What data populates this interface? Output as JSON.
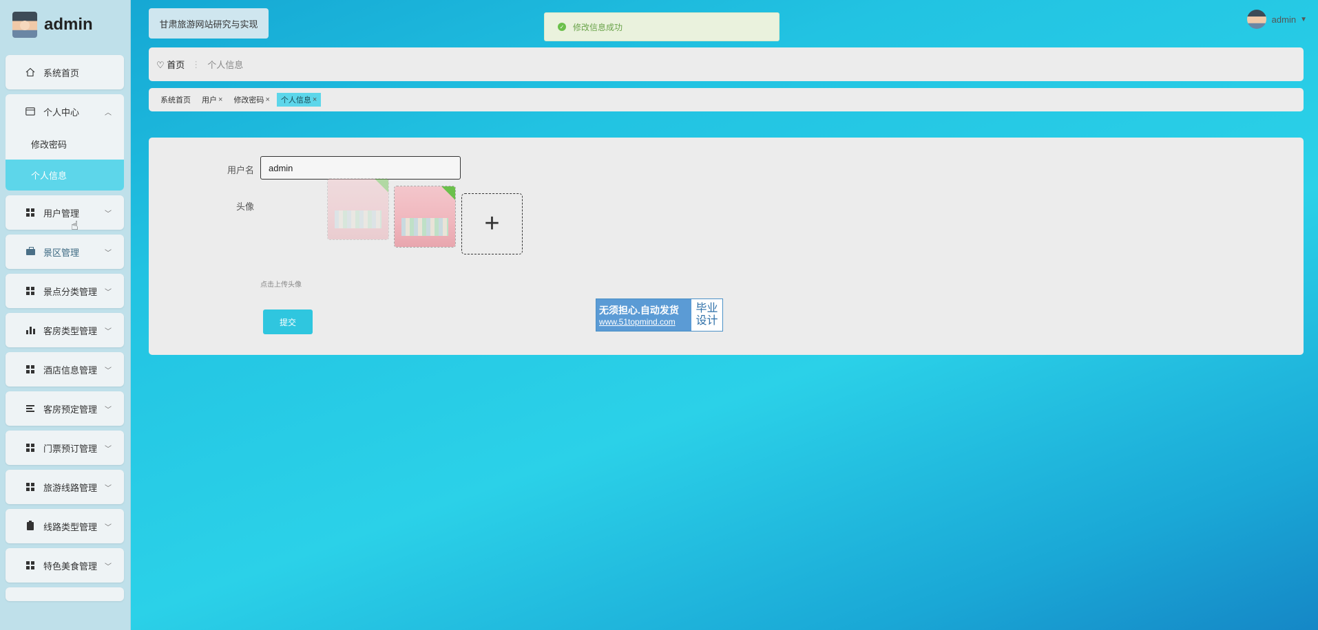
{
  "brand": {
    "name": "admin"
  },
  "sidebar": {
    "items": [
      {
        "label": "系统首页"
      },
      {
        "label": "个人中心",
        "children": [
          "修改密码",
          "个人信息"
        ]
      },
      {
        "label": "用户管理"
      },
      {
        "label": "景区管理"
      },
      {
        "label": "景点分类管理"
      },
      {
        "label": "客房类型管理"
      },
      {
        "label": "酒店信息管理"
      },
      {
        "label": "客房预定管理"
      },
      {
        "label": "门票预订管理"
      },
      {
        "label": "旅游线路管理"
      },
      {
        "label": "线路类型管理"
      },
      {
        "label": "特色美食管理"
      }
    ],
    "active_sub": "个人信息"
  },
  "header": {
    "site_title": "甘肃旅游网站研究与实现",
    "toast": "修改信息成功",
    "user": "admin"
  },
  "breadcrumb": {
    "home": "首页",
    "current": "个人信息"
  },
  "tabs": [
    {
      "label": "系统首页",
      "closable": false
    },
    {
      "label": "用户",
      "closable": true
    },
    {
      "label": "修改密码",
      "closable": true
    },
    {
      "label": "个人信息",
      "closable": true,
      "active": true
    }
  ],
  "form": {
    "username_label": "用户名",
    "username_value": "admin",
    "avatar_label": "头像",
    "upload_hint": "点击上传头像",
    "submit_label": "提交"
  },
  "watermark": {
    "line1": "无须担心.自动发货",
    "line2": "www.51topmind.com",
    "right1": "毕业",
    "right2": "设计"
  },
  "colors": {
    "accent": "#2fc6df",
    "active_bg": "#5dd6ea",
    "success": "#6bc04b"
  }
}
